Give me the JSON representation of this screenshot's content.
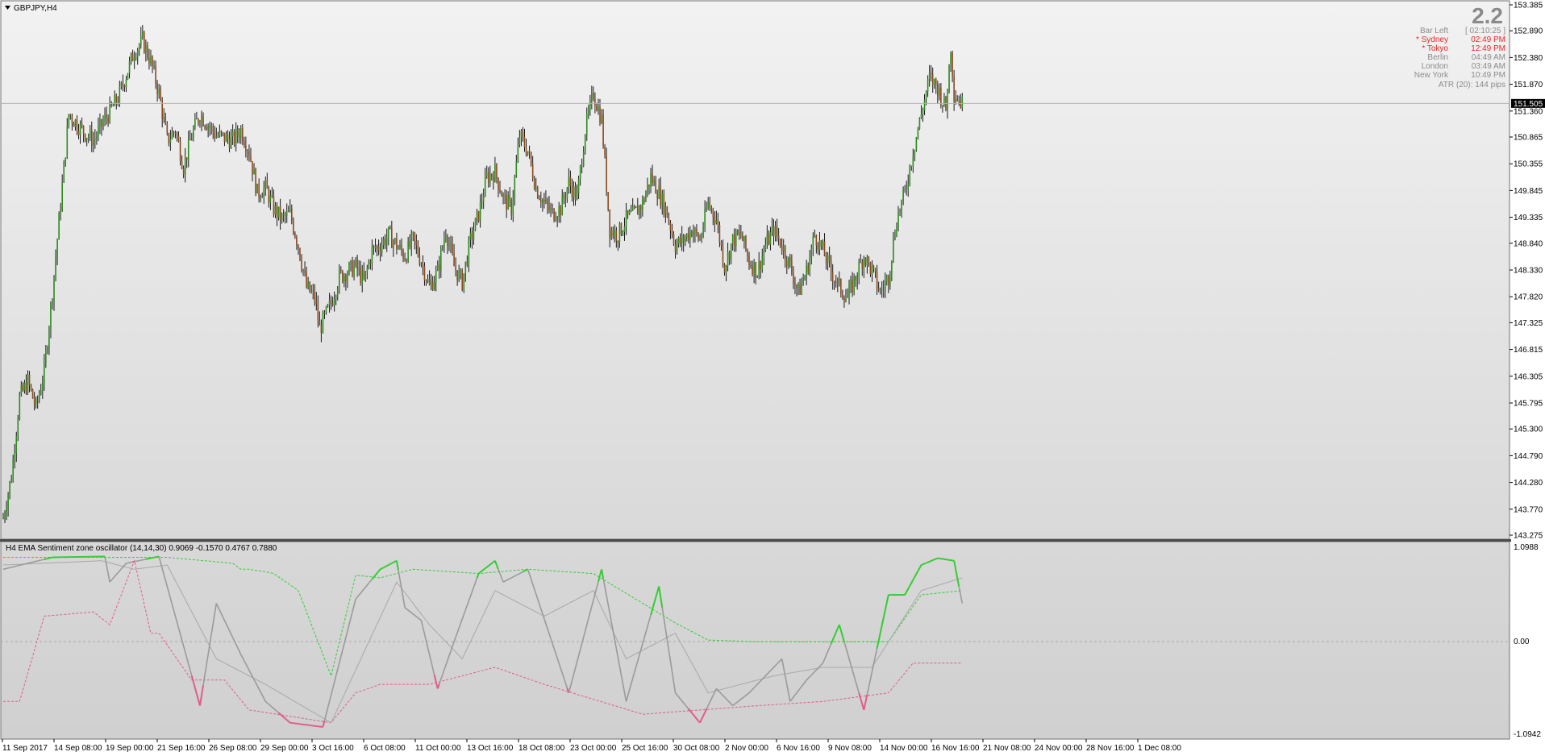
{
  "main_window": {
    "symbol_title": "GBPJPY,H4",
    "current_price_label": "151.505",
    "price_axis_labels": [
      "153.385",
      "152.890",
      "152.380",
      "151.870",
      "151.360",
      "150.865",
      "150.355",
      "149.845",
      "149.335",
      "148.840",
      "148.330",
      "147.820",
      "147.325",
      "146.815",
      "146.305",
      "145.795",
      "145.300",
      "144.790",
      "144.280",
      "143.770",
      "143.275"
    ]
  },
  "info_panel": {
    "big_value": "2.2",
    "rows": [
      {
        "label": "Bar Left",
        "value": "[ 02:10:25 ]",
        "color": "#8c8c8c"
      },
      {
        "label": "* Sydney",
        "value": "02:49 PM",
        "color": "#e8262b"
      },
      {
        "label": "* Tokyo",
        "value": "12:49 PM",
        "color": "#e8262b"
      },
      {
        "label": "Berlin",
        "value": "04:49 AM",
        "color": "#8c8c8c"
      },
      {
        "label": "London",
        "value": "03:49 AM",
        "color": "#8c8c8c"
      },
      {
        "label": "New York",
        "value": "10:49 PM",
        "color": "#8c8c8c"
      }
    ],
    "atr_text": "ATR (20): 144 pips"
  },
  "sub_window": {
    "indicator_title": "H4 EMA Sentiment zone oscillator (14,14,30) 0.9069 -0.1570 0.4767 0.7880",
    "axis_labels": [
      "1.0988",
      "0.00",
      "-1.0942"
    ]
  },
  "time_axis_labels": [
    "11 Sep 2017",
    "14 Sep 08:00",
    "19 Sep 00:00",
    "21 Sep 16:00",
    "26 Sep 08:00",
    "29 Sep 00:00",
    "3 Oct 16:00",
    "6 Oct 08:00",
    "11 Oct 00:00",
    "13 Oct 16:00",
    "18 Oct 08:00",
    "23 Oct 00:00",
    "25 Oct 16:00",
    "30 Oct 08:00",
    "2 Nov 00:00",
    "6 Nov 16:00",
    "9 Nov 08:00",
    "14 Nov 00:00",
    "16 Nov 16:00",
    "21 Nov 08:00",
    "24 Nov 00:00",
    "28 Nov 16:00",
    "1 Dec 08:00"
  ],
  "colors": {
    "bull_candle": "#2e8b1e",
    "bear_candle": "#8b4a1e",
    "wick": "#1a1a1a",
    "osc_up": "#32cd32",
    "osc_down": "#e05c8a",
    "osc_neutral": "#9a9a9a",
    "level_up": "#32cd32",
    "level_down": "#e05c8a",
    "price_tag_bg": "#000000"
  },
  "chart_data": [
    {
      "type": "candlestick",
      "title": "GBPJPY,H4",
      "ylim": [
        143.275,
        153.385
      ],
      "anchors_close": [
        [
          0,
          143.6
        ],
        [
          5,
          144.4
        ],
        [
          10,
          145.9
        ],
        [
          15,
          146.2
        ],
        [
          20,
          145.7
        ],
        [
          25,
          146.4
        ],
        [
          30,
          147.9
        ],
        [
          35,
          149.6
        ],
        [
          40,
          151.3
        ],
        [
          48,
          151.0
        ],
        [
          55,
          150.8
        ],
        [
          62,
          151.2
        ],
        [
          70,
          151.6
        ],
        [
          80,
          152.5
        ],
        [
          85,
          152.7
        ],
        [
          90,
          152.3
        ],
        [
          95,
          151.7
        ],
        [
          100,
          150.8
        ],
        [
          105,
          151.0
        ],
        [
          110,
          150.3
        ],
        [
          115,
          150.9
        ],
        [
          120,
          151.3
        ],
        [
          130,
          150.9
        ],
        [
          140,
          150.8
        ],
        [
          145,
          151.0
        ],
        [
          150,
          150.6
        ],
        [
          155,
          149.8
        ],
        [
          160,
          149.9
        ],
        [
          165,
          149.5
        ],
        [
          170,
          149.3
        ],
        [
          175,
          149.4
        ],
        [
          180,
          148.8
        ],
        [
          185,
          148.0
        ],
        [
          190,
          147.8
        ],
        [
          193,
          147.2
        ],
        [
          200,
          147.7
        ],
        [
          205,
          148.2
        ],
        [
          210,
          148.3
        ],
        [
          215,
          148.4
        ],
        [
          220,
          148.1
        ],
        [
          225,
          148.7
        ],
        [
          230,
          148.8
        ],
        [
          235,
          149.0
        ],
        [
          240,
          148.8
        ],
        [
          245,
          148.6
        ],
        [
          250,
          148.9
        ],
        [
          255,
          148.5
        ],
        [
          260,
          148.0
        ],
        [
          265,
          148.3
        ],
        [
          270,
          149.1
        ],
        [
          275,
          148.4
        ],
        [
          280,
          148.1
        ],
        [
          285,
          148.9
        ],
        [
          290,
          149.4
        ],
        [
          295,
          150.1
        ],
        [
          300,
          150.2
        ],
        [
          305,
          149.7
        ],
        [
          310,
          149.5
        ],
        [
          315,
          150.9
        ],
        [
          320,
          150.6
        ],
        [
          325,
          149.9
        ],
        [
          330,
          149.6
        ],
        [
          335,
          149.4
        ],
        [
          340,
          149.5
        ],
        [
          345,
          150.0
        ],
        [
          350,
          149.7
        ],
        [
          355,
          151.0
        ],
        [
          360,
          151.7
        ],
        [
          365,
          151.2
        ],
        [
          370,
          149.1
        ],
        [
          375,
          149.0
        ],
        [
          380,
          149.3
        ],
        [
          385,
          149.4
        ],
        [
          390,
          149.6
        ],
        [
          395,
          150.1
        ],
        [
          400,
          149.8
        ],
        [
          405,
          149.4
        ],
        [
          410,
          148.8
        ],
        [
          415,
          148.9
        ],
        [
          420,
          149.1
        ],
        [
          425,
          148.9
        ],
        [
          430,
          149.6
        ],
        [
          435,
          149.3
        ],
        [
          440,
          148.4
        ],
        [
          445,
          148.9
        ],
        [
          450,
          149.0
        ],
        [
          455,
          148.5
        ],
        [
          460,
          148.3
        ],
        [
          465,
          148.8
        ],
        [
          470,
          149.1
        ],
        [
          475,
          148.8
        ],
        [
          480,
          148.4
        ],
        [
          485,
          147.9
        ],
        [
          490,
          148.3
        ],
        [
          495,
          149.0
        ],
        [
          500,
          148.7
        ],
        [
          505,
          148.3
        ],
        [
          510,
          148.0
        ],
        [
          515,
          147.8
        ],
        [
          520,
          148.2
        ],
        [
          525,
          148.6
        ],
        [
          530,
          148.3
        ],
        [
          535,
          147.9
        ],
        [
          540,
          148.2
        ],
        [
          545,
          149.3
        ],
        [
          550,
          149.8
        ],
        [
          555,
          150.6
        ],
        [
          560,
          151.3
        ],
        [
          565,
          152.0
        ],
        [
          570,
          151.8
        ],
        [
          575,
          151.4
        ],
        [
          578,
          152.6
        ],
        [
          580,
          151.7
        ],
        [
          585,
          151.5
        ]
      ]
    },
    {
      "type": "line",
      "title": "H4 EMA Sentiment zone oscillator (14,14,30) 0.9069 -0.1570 0.4767 0.7880",
      "ylim": [
        -1.0942,
        1.0988
      ],
      "series": [
        {
          "values_anchors": [
            [
              0,
              0.85
            ],
            [
              30,
              0.99
            ],
            [
              62,
              1.0
            ],
            [
              65,
              0.7
            ],
            [
              75,
              0.92
            ],
            [
              95,
              1.0
            ],
            [
              120,
              -0.75
            ],
            [
              130,
              0.45
            ],
            [
              145,
              -0.15
            ],
            [
              160,
              -0.7
            ],
            [
              175,
              -0.95
            ],
            [
              195,
              -1.0
            ],
            [
              215,
              0.5
            ],
            [
              230,
              0.85
            ],
            [
              240,
              0.95
            ],
            [
              245,
              0.4
            ],
            [
              255,
              0.25
            ],
            [
              265,
              -0.55
            ],
            [
              275,
              0.0
            ],
            [
              290,
              0.8
            ],
            [
              300,
              0.95
            ],
            [
              305,
              0.7
            ],
            [
              320,
              0.85
            ],
            [
              345,
              -0.6
            ],
            [
              365,
              0.85
            ],
            [
              380,
              -0.7
            ],
            [
              400,
              0.65
            ],
            [
              410,
              -0.6
            ],
            [
              425,
              -0.95
            ],
            [
              435,
              -0.55
            ],
            [
              445,
              -0.75
            ],
            [
              455,
              -0.6
            ],
            [
              465,
              -0.4
            ],
            [
              475,
              -0.2
            ],
            [
              480,
              -0.7
            ],
            [
              490,
              -0.45
            ],
            [
              500,
              -0.25
            ],
            [
              510,
              0.2
            ],
            [
              525,
              -0.8
            ],
            [
              540,
              0.55
            ],
            [
              550,
              0.55
            ],
            [
              560,
              0.9
            ],
            [
              570,
              0.98
            ],
            [
              580,
              0.95
            ],
            [
              585,
              0.45
            ]
          ]
        },
        {
          "name": "",
          "values_anchors": [
            [
              0,
              0.9
            ],
            [
              60,
              0.95
            ],
            [
              80,
              0.85
            ],
            [
              100,
              0.9
            ],
            [
              130,
              -0.2
            ],
            [
              160,
              -0.5
            ],
            [
              200,
              -0.95
            ],
            [
              240,
              0.7
            ],
            [
              260,
              0.2
            ],
            [
              280,
              -0.2
            ],
            [
              300,
              0.6
            ],
            [
              330,
              0.3
            ],
            [
              360,
              0.6
            ],
            [
              380,
              -0.2
            ],
            [
              410,
              0.1
            ],
            [
              430,
              -0.6
            ],
            [
              470,
              -0.4
            ],
            [
              500,
              -0.3
            ],
            [
              530,
              -0.3
            ],
            [
              560,
              0.6
            ],
            [
              585,
              0.75
            ]
          ]
        }
      ],
      "levels": {
        "upper_anchors": [
          [
            0,
            0.99
          ],
          [
            100,
            0.99
          ],
          [
            140,
            0.92
          ],
          [
            145,
            0.85
          ],
          [
            150,
            0.85
          ],
          [
            160,
            0.82
          ],
          [
            165,
            0.8
          ],
          [
            180,
            0.6
          ],
          [
            200,
            -0.4
          ],
          [
            215,
            0.78
          ],
          [
            230,
            0.75
          ],
          [
            250,
            0.85
          ],
          [
            290,
            0.8
          ],
          [
            320,
            0.85
          ],
          [
            360,
            0.8
          ],
          [
            410,
            0.22
          ],
          [
            430,
            0.02
          ],
          [
            460,
            0.0
          ],
          [
            500,
            0.0
          ],
          [
            540,
            0.0
          ],
          [
            560,
            0.55
          ],
          [
            585,
            0.6
          ]
        ],
        "lower_anchors": [
          [
            0,
            -0.7
          ],
          [
            10,
            -0.7
          ],
          [
            25,
            0.3
          ],
          [
            55,
            0.35
          ],
          [
            65,
            0.2
          ],
          [
            80,
            0.95
          ],
          [
            90,
            0.1
          ],
          [
            95,
            0.1
          ],
          [
            115,
            -0.45
          ],
          [
            135,
            -0.45
          ],
          [
            150,
            -0.8
          ],
          [
            200,
            -0.95
          ],
          [
            215,
            -0.6
          ],
          [
            230,
            -0.5
          ],
          [
            260,
            -0.5
          ],
          [
            300,
            -0.3
          ],
          [
            330,
            -0.5
          ],
          [
            390,
            -0.85
          ],
          [
            460,
            -0.75
          ],
          [
            500,
            -0.7
          ],
          [
            540,
            -0.6
          ],
          [
            555,
            -0.25
          ],
          [
            585,
            -0.25
          ]
        ]
      }
    }
  ]
}
